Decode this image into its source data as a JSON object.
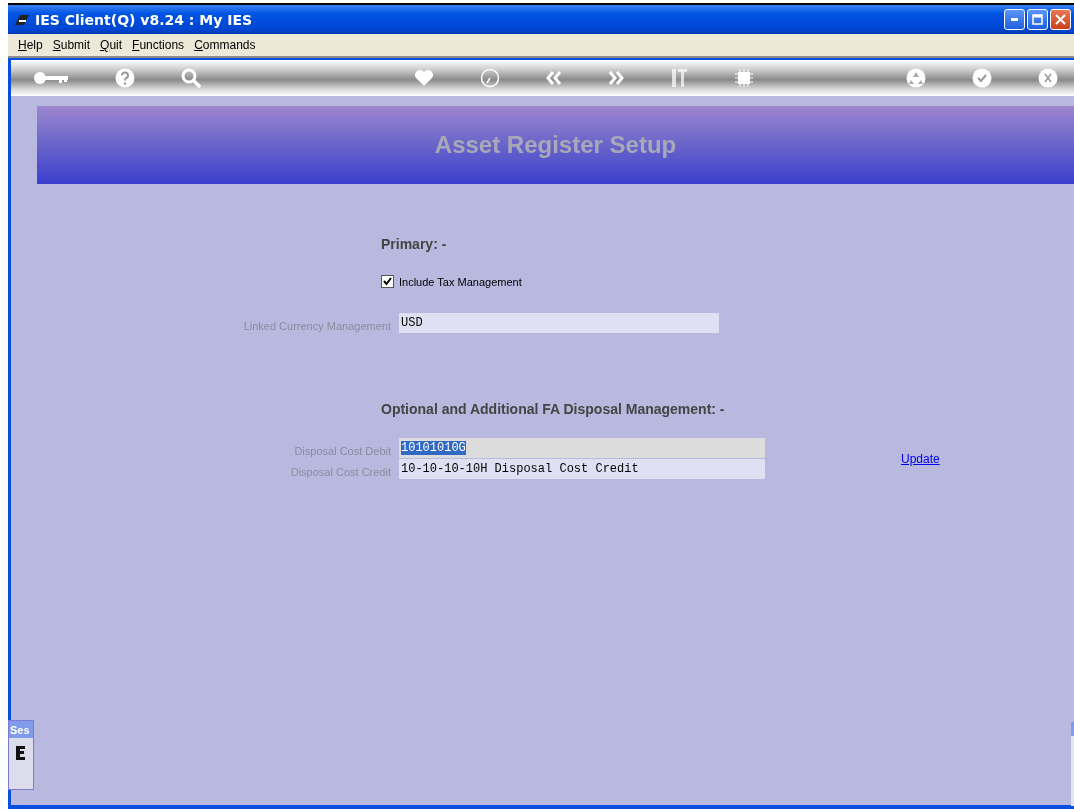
{
  "window": {
    "title": "IES Client(Q) v8.24 : My IES"
  },
  "menu": [
    {
      "label": "Help"
    },
    {
      "label": "Submit"
    },
    {
      "label": "Quit"
    },
    {
      "label": "Functions"
    },
    {
      "label": "Commands"
    }
  ],
  "toolbar": {
    "left": [
      {
        "kind": "key"
      },
      {
        "kind": "help"
      },
      {
        "kind": "search"
      }
    ],
    "center": [
      {
        "kind": "heart"
      },
      {
        "kind": "clock"
      },
      {
        "kind": "back"
      },
      {
        "kind": "forward"
      },
      {
        "kind": "tools"
      },
      {
        "kind": "chip"
      }
    ],
    "right": [
      {
        "kind": "recycle"
      },
      {
        "kind": "check"
      },
      {
        "kind": "close"
      }
    ]
  },
  "page_title": "Asset Register Setup",
  "primary": {
    "heading": "Primary: -",
    "checkbox": {
      "label": "Include Tax Management",
      "checked": true
    },
    "fields": [
      {
        "label": "Linked Currency Management",
        "value": "USD",
        "selected": false
      }
    ]
  },
  "disposal": {
    "heading": "Optional and Additional FA Disposal Management: -",
    "fields": [
      {
        "label": "Disposal Cost Debit",
        "value": "10101010G",
        "selected": true
      },
      {
        "label": "Disposal Cost Credit",
        "value": "10-10-10-10H Disposal Cost Credit",
        "selected": false
      }
    ],
    "link": "Update"
  },
  "session_panel": {
    "title": "Ses"
  }
}
